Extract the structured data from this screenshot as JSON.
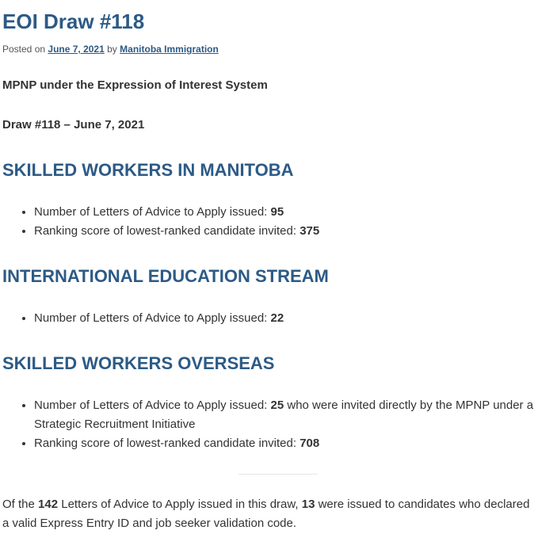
{
  "post": {
    "title": "EOI Draw #118",
    "posted_on_prefix": "Posted on",
    "date_link": "June 7, 2021",
    "by_text": "by",
    "author_link": "Manitoba Immigration"
  },
  "intro": {
    "system_heading": "MPNP under the Expression of Interest System",
    "draw_heading": "Draw #118 – June 7, 2021"
  },
  "sections": [
    {
      "heading": "SKILLED WORKERS IN MANITOBA",
      "items": [
        {
          "text": "Number of Letters of Advice to Apply issued: ",
          "value": "95",
          "suffix": ""
        },
        {
          "text": "Ranking score of lowest-ranked candidate invited: ",
          "value": "375",
          "suffix": ""
        }
      ]
    },
    {
      "heading": "INTERNATIONAL EDUCATION STREAM",
      "items": [
        {
          "text": "Number of Letters of Advice to Apply issued: ",
          "value": "22",
          "suffix": ""
        }
      ]
    },
    {
      "heading": "SKILLED WORKERS OVERSEAS",
      "items": [
        {
          "text": "Number of Letters of Advice to Apply issued: ",
          "value": "25",
          "suffix": " who were invited directly by the MPNP under a Strategic Recruitment Initiative"
        },
        {
          "text": "Ranking score of lowest-ranked candidate invited: ",
          "value": "708",
          "suffix": ""
        }
      ]
    }
  ],
  "closing": {
    "part1": "Of the ",
    "total": "142",
    "part2": " Letters of Advice to Apply issued in this draw, ",
    "express_count": "13",
    "part3": " were issued to candidates who declared a valid Express Entry ID and job seeker validation code."
  }
}
